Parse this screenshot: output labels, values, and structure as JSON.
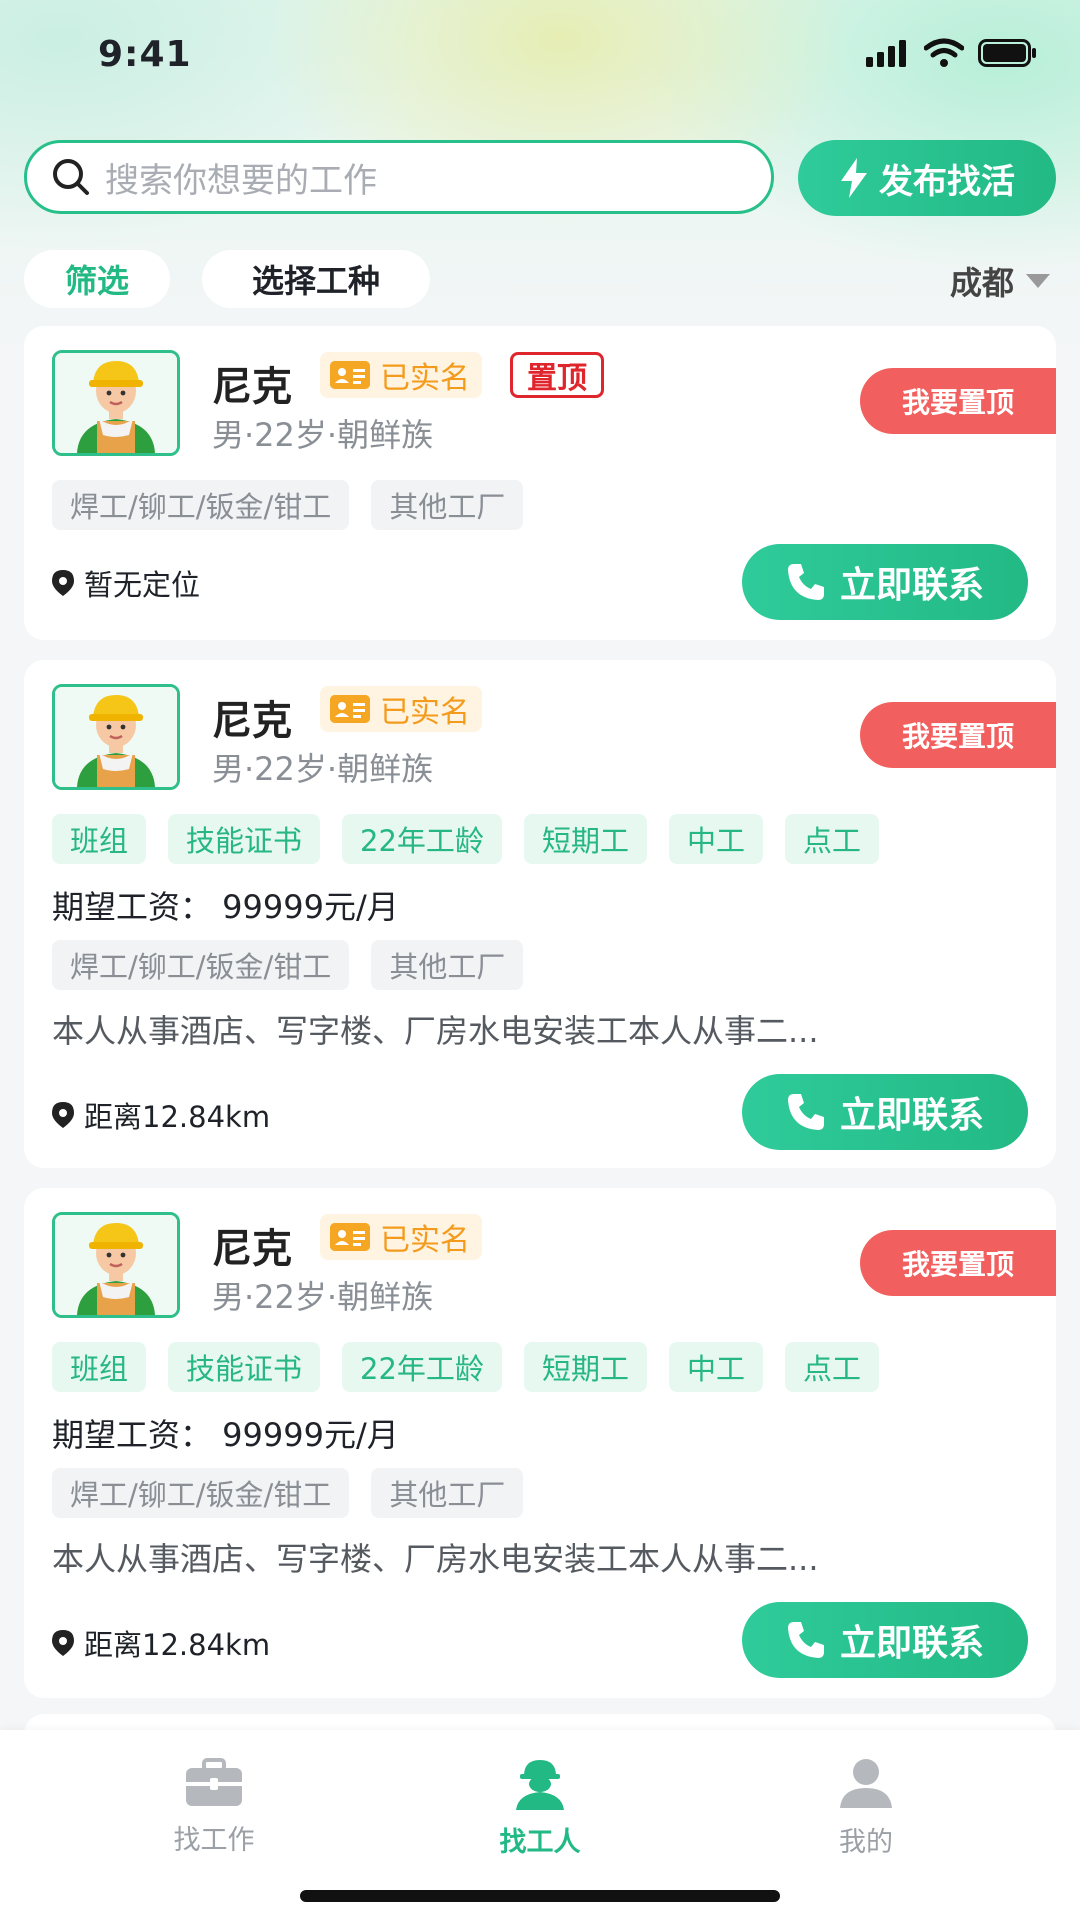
{
  "status_bar": {
    "time": "9:41"
  },
  "search": {
    "placeholder": "搜索你想要的工作"
  },
  "publish_button": {
    "label": "发布找活"
  },
  "filters": {
    "filter_label": "筛选",
    "trade_label": "选择工种",
    "city": "成都"
  },
  "colors": {
    "brand_green": "#22b985",
    "pin_red": "#f15f5f",
    "badge_orange": "#f39b1c"
  },
  "cards": [
    {
      "name": "尼克",
      "verified": "已实名",
      "pinned_badge": "置顶",
      "meta": "男·22岁·朝鲜族",
      "pin_button": "我要置顶",
      "trade_tags": [
        "焊工/铆工/钣金/钳工",
        "其他工厂"
      ],
      "location": "暂无定位",
      "contact_button": "立即联系"
    },
    {
      "name": "尼克",
      "verified": "已实名",
      "meta": "男·22岁·朝鲜族",
      "pin_button": "我要置顶",
      "skill_tags": [
        "班组",
        "技能证书",
        "22年工龄",
        "短期工",
        "中工",
        "点工"
      ],
      "salary": "期望工资： 99999元/月",
      "trade_tags": [
        "焊工/铆工/钣金/钳工",
        "其他工厂"
      ],
      "description": "本人从事酒店、写字楼、厂房水电安装工本人从事二...",
      "location": "距离12.84km",
      "contact_button": "立即联系"
    },
    {
      "name": "尼克",
      "verified": "已实名",
      "meta": "男·22岁·朝鲜族",
      "pin_button": "我要置顶",
      "skill_tags": [
        "班组",
        "技能证书",
        "22年工龄",
        "短期工",
        "中工",
        "点工"
      ],
      "salary": "期望工资： 99999元/月",
      "trade_tags": [
        "焊工/铆工/钣金/钳工",
        "其他工厂"
      ],
      "description": "本人从事酒店、写字楼、厂房水电安装工本人从事二...",
      "location": "距离12.84km",
      "contact_button": "立即联系"
    }
  ],
  "tab_bar": {
    "tabs": [
      {
        "label": "找工作",
        "icon": "briefcase-icon"
      },
      {
        "label": "找工人",
        "icon": "worker-icon"
      },
      {
        "label": "我的",
        "icon": "person-icon"
      }
    ]
  }
}
